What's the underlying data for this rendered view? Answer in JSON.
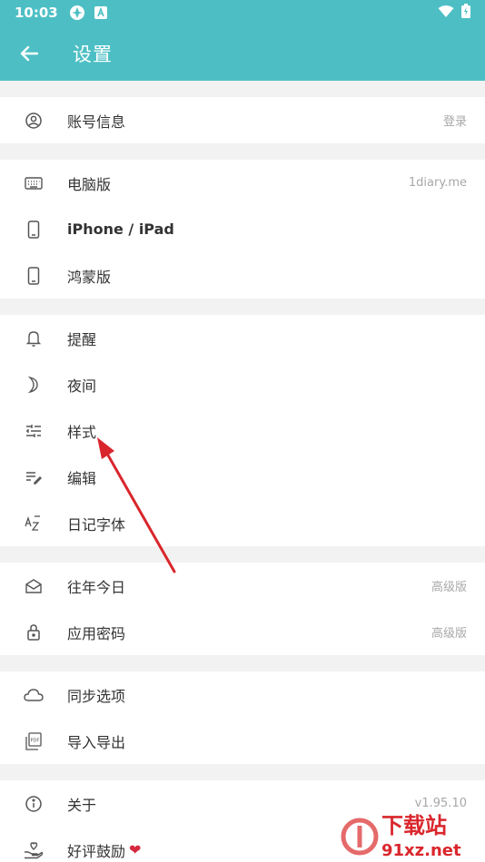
{
  "status_bar": {
    "time": "10:03"
  },
  "app_bar": {
    "title": "设置"
  },
  "groups": [
    {
      "rows": [
        {
          "label": "账号信息",
          "value": "登录",
          "icon": "user-circle-icon"
        }
      ]
    },
    {
      "rows": [
        {
          "label": "电脑版",
          "value": "1diary.me",
          "icon": "keyboard-icon"
        },
        {
          "label": "iPhone / iPad",
          "value": "",
          "icon": "phone-icon"
        },
        {
          "label": "鸿蒙版",
          "value": "",
          "icon": "phone-icon"
        }
      ]
    },
    {
      "rows": [
        {
          "label": "提醒",
          "value": "",
          "icon": "bell-icon"
        },
        {
          "label": "夜间",
          "value": "",
          "icon": "moon-icon"
        },
        {
          "label": "样式",
          "value": "",
          "icon": "sliders-icon"
        },
        {
          "label": "编辑",
          "value": "",
          "icon": "edit-list-icon"
        },
        {
          "label": "日记字体",
          "value": "",
          "icon": "font-az-icon"
        }
      ]
    },
    {
      "rows": [
        {
          "label": "往年今日",
          "value": "高级版",
          "icon": "envelope-open-icon"
        },
        {
          "label": "应用密码",
          "value": "高级版",
          "icon": "lock-icon"
        }
      ]
    },
    {
      "rows": [
        {
          "label": "同步选项",
          "value": "",
          "icon": "cloud-icon"
        },
        {
          "label": "导入导出",
          "value": "",
          "icon": "pdf-file-icon"
        }
      ]
    },
    {
      "rows": [
        {
          "label": "关于",
          "value": "v1.95.10",
          "icon": "info-icon"
        },
        {
          "label": "好评鼓励",
          "value": "",
          "icon": "hand-heart-icon"
        }
      ]
    }
  ],
  "watermark": {
    "text_main": "下载站",
    "text_sub": "91xz.net"
  },
  "colors": {
    "accent": "#4dbfc4",
    "arrow": "#d9262c",
    "heart": "#d6283e"
  }
}
